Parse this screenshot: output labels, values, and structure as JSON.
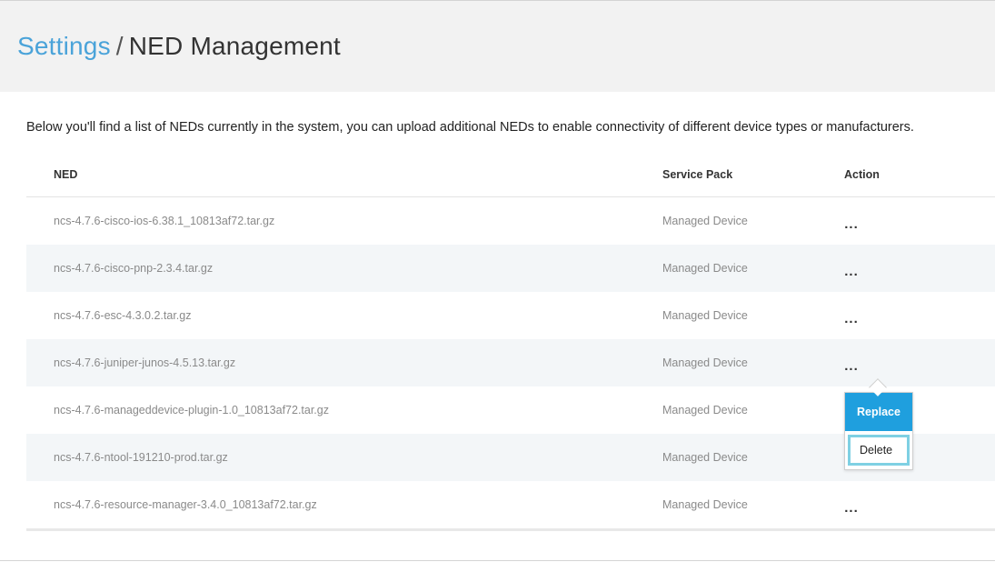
{
  "header": {
    "breadcrumb_root": "Settings",
    "separator": "/",
    "page_title": "NED Management"
  },
  "intro_text": "Below you'll find a list of NEDs currently in the system, you can upload additional NEDs to enable connectivity of different device types or manufacturers.",
  "table": {
    "columns": [
      "NED",
      "Service Pack",
      "Action"
    ],
    "rows": [
      {
        "ned": "ncs-4.7.6-cisco-ios-6.38.1_10813af72.tar.gz",
        "service_pack": "Managed Device",
        "action": "..."
      },
      {
        "ned": "ncs-4.7.6-cisco-pnp-2.3.4.tar.gz",
        "service_pack": "Managed Device",
        "action": "..."
      },
      {
        "ned": "ncs-4.7.6-esc-4.3.0.2.tar.gz",
        "service_pack": "Managed Device",
        "action": "..."
      },
      {
        "ned": "ncs-4.7.6-juniper-junos-4.5.13.tar.gz",
        "service_pack": "Managed Device",
        "action": "..."
      },
      {
        "ned": "ncs-4.7.6-manageddevice-plugin-1.0_10813af72.tar.gz",
        "service_pack": "Managed Device",
        "action": ""
      },
      {
        "ned": "ncs-4.7.6-ntool-191210-prod.tar.gz",
        "service_pack": "Managed Device",
        "action": ""
      },
      {
        "ned": "ncs-4.7.6-resource-manager-3.4.0_10813af72.tar.gz",
        "service_pack": "Managed Device",
        "action": "..."
      }
    ]
  },
  "action_menu": {
    "replace_label": "Replace",
    "delete_label": "Delete"
  },
  "colors": {
    "accent": "#4aa3d9",
    "replace_bg": "#1f9fde",
    "delete_focus": "#7fd0e3",
    "alt_row": "#f3f6f8"
  }
}
